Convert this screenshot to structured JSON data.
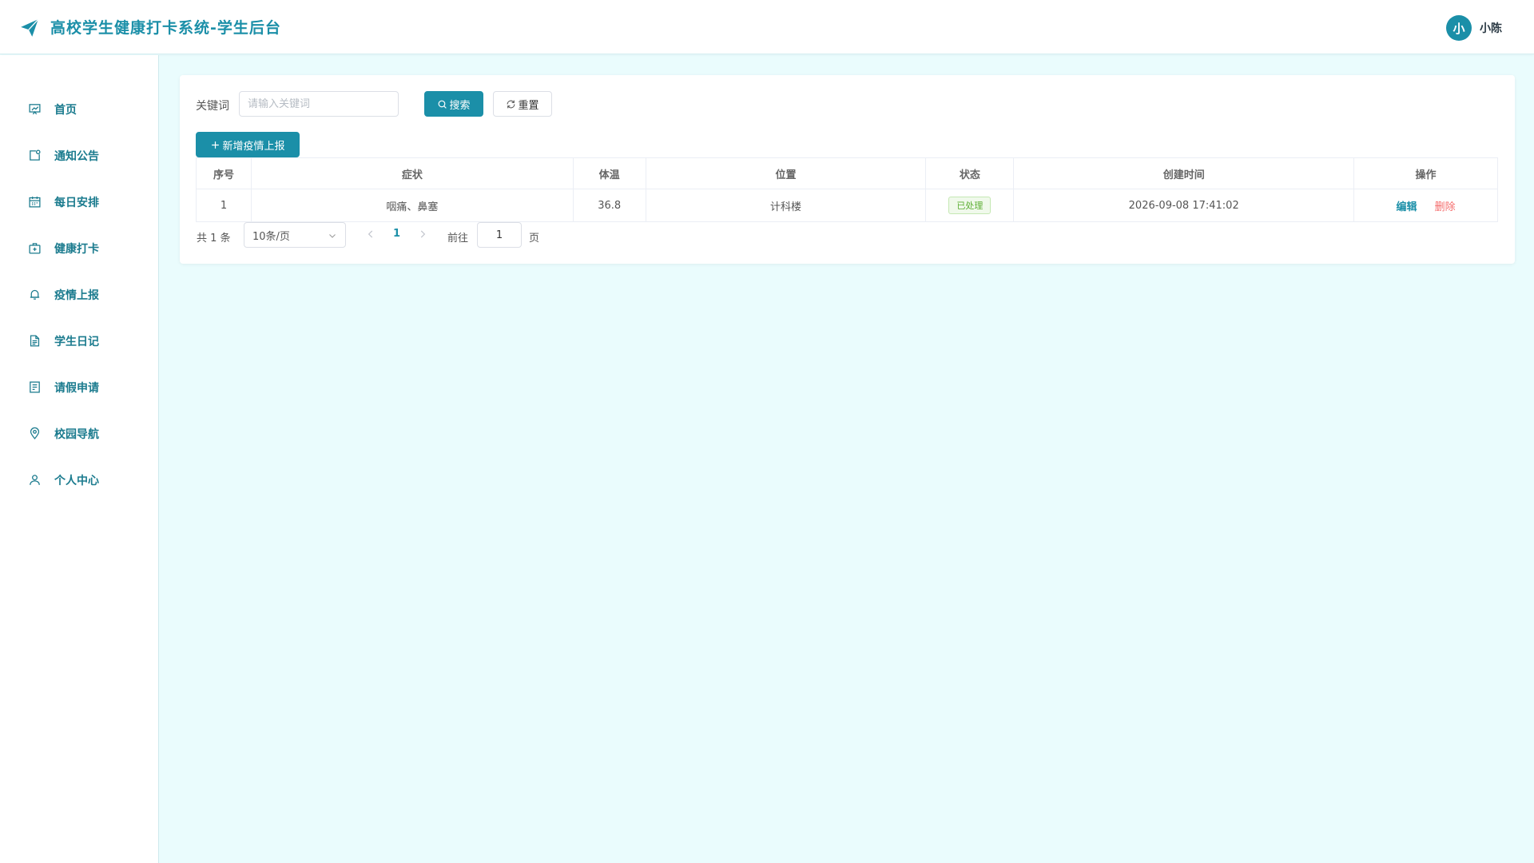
{
  "header": {
    "logo_icon": "paper-plane-icon",
    "title": "高校学生健康打卡系统-学生后台",
    "avatar_text": "小",
    "username": "小陈"
  },
  "sidebar": {
    "items": [
      {
        "label": "首页",
        "icon": "dashboard-icon"
      },
      {
        "label": "通知公告",
        "icon": "notice-icon"
      },
      {
        "label": "每日安排",
        "icon": "calendar-icon"
      },
      {
        "label": "健康打卡",
        "icon": "first-aid-icon"
      },
      {
        "label": "疫情上报",
        "icon": "bell-icon"
      },
      {
        "label": "学生日记",
        "icon": "document-icon"
      },
      {
        "label": "请假申请",
        "icon": "form-icon"
      },
      {
        "label": "校园导航",
        "icon": "location-icon"
      },
      {
        "label": "个人中心",
        "icon": "user-icon"
      }
    ],
    "active_index": 4
  },
  "search": {
    "label": "关键词",
    "placeholder": "请输入关键词",
    "value": "",
    "search_button": "搜索",
    "reset_button": "重置"
  },
  "toolbar": {
    "add_button": "新增疫情上报"
  },
  "table": {
    "columns": [
      "序号",
      "症状",
      "体温",
      "位置",
      "状态",
      "创建时间",
      "操作"
    ],
    "rows": [
      {
        "index": "1",
        "symptom": "咽痛、鼻塞",
        "temperature": "36.8",
        "location": "计科楼",
        "status": "已处理",
        "created_at": "2026-09-08 17:41:02",
        "edit": "编辑",
        "delete": "删除"
      }
    ]
  },
  "pagination": {
    "total_text": "共 1 条",
    "page_size": "10条/页",
    "current_page": "1",
    "goto_label": "前往",
    "goto_value": "1",
    "page_suffix": "页"
  },
  "colors": {
    "primary": "#1b8fa8",
    "background": "#eafcfd",
    "danger": "#f56c6c",
    "success": "#5daf34"
  }
}
